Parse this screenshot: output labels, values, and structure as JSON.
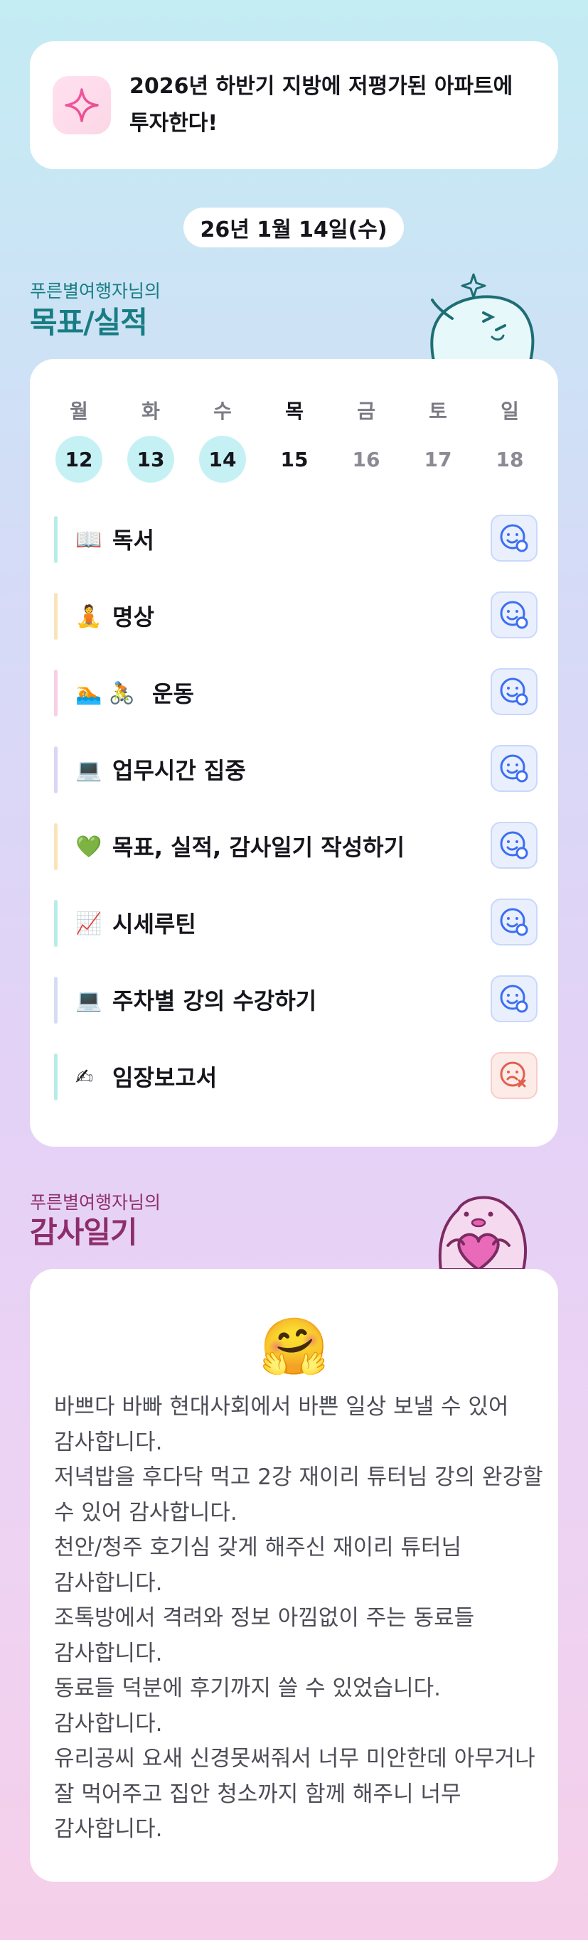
{
  "goal": {
    "icon": "sparkle-icon",
    "text": "2026년 하반기 지방에 저평가된 아파트에 투자한다!"
  },
  "date_label": "26년 1월 14일(수)",
  "goals_section": {
    "subtitle": "푸른별여행자님의",
    "title": "목표/실적"
  },
  "week": {
    "days": [
      {
        "name": "월",
        "num": "12",
        "state": "done"
      },
      {
        "name": "화",
        "num": "13",
        "state": "done"
      },
      {
        "name": "수",
        "num": "14",
        "state": "done"
      },
      {
        "name": "목",
        "num": "15",
        "state": "today"
      },
      {
        "name": "금",
        "num": "16",
        "state": "future"
      },
      {
        "name": "토",
        "num": "17",
        "state": "future"
      },
      {
        "name": "일",
        "num": "18",
        "state": "future"
      }
    ]
  },
  "habits": [
    {
      "emoji": "📖",
      "label": "독서",
      "color": "#b8ece8",
      "status": "achieved"
    },
    {
      "emoji": "🧘",
      "label": "명상",
      "color": "#fbe3b9",
      "status": "achieved"
    },
    {
      "emoji": "🏊 🚴",
      "label": "운동",
      "color": "#f9cfe6",
      "status": "achieved"
    },
    {
      "emoji": "💻",
      "label": "업무시간 집중",
      "color": "#dcd5f6",
      "status": "achieved"
    },
    {
      "emoji": "💚",
      "label": "목표, 실적, 감사일기 작성하기",
      "color": "#fbe3b9",
      "status": "achieved"
    },
    {
      "emoji": "📈",
      "label": "시세루틴",
      "color": "#b8ece8",
      "status": "achieved"
    },
    {
      "emoji": "💻",
      "label": "주차별 강의 수강하기",
      "color": "#d6dcf5",
      "status": "achieved"
    },
    {
      "emoji": "✍",
      "label": "임장보고서",
      "color": "#b8ece8",
      "status": "missed"
    }
  ],
  "gratitude_section": {
    "subtitle": "푸른별여행자님의",
    "title": "감사일기"
  },
  "gratitude": {
    "emoji": "🤗",
    "text": "바쁘다 바빠 현대사회에서 바쁜 일상 보낼 수 있어 감사합니다.\n저녁밥을 후다닥 먹고 2강 재이리 튜터님 강의 완강할 수 있어 감사합니다.\n천안/청주 호기심 갖게 해주신 재이리 튜터님 감사합니다.\n조톡방에서 격려와 정보 아낌없이 주는 동료들 감사합니다.\n동료들 덕분에 후기까지 쓸 수 있었습니다. 감사합니다.\n유리공씨 요새 신경못써줘서 너무 미안한데 아무거나 잘 먹어주고 집안 청소까지 함께 해주니 너무 감사합니다."
  },
  "colors": {
    "accent_teal": "#177d83",
    "accent_plum": "#8e2d6d",
    "achieved_blue": "#3b6ef0",
    "missed_red": "#e1604e"
  }
}
